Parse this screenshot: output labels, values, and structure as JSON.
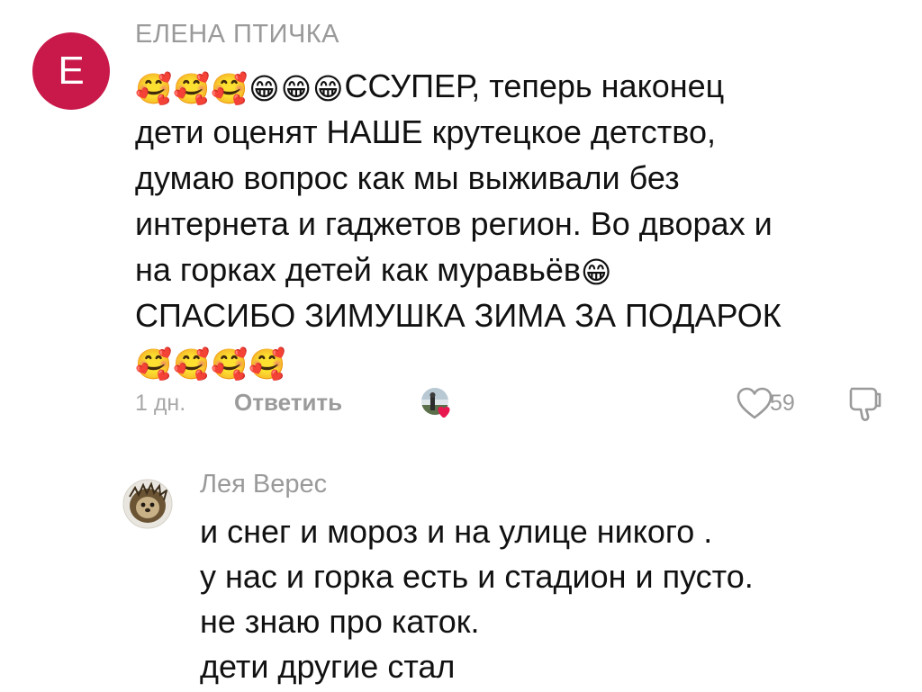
{
  "comment": {
    "avatar_letter": "E",
    "author": "ЕЛЕНА ПТИЧКА",
    "lines": [
      {
        "emojis": [
          "🥰",
          "🥰",
          "🥰",
          "😁",
          "😁",
          "😁"
        ],
        "text": "ССУПЕР, теперь наконец"
      },
      {
        "emojis": [],
        "text": "дети оценят НАШЕ крутецкое детство,"
      },
      {
        "emojis": [],
        "text": "думаю вопрос как мы выживали без"
      },
      {
        "emojis": [],
        "text": "интернета и гаджетов регион. Во дворах и"
      },
      {
        "emojis": [],
        "text": "на горках детей как муравьёв",
        "trailing_emoji": "😁"
      },
      {
        "emojis": [],
        "text": "СПАСИБО ЗИМУШКА ЗИМА ЗА ПОДАРОК"
      },
      {
        "emojis": [
          "🥰",
          "🥰",
          "🥰",
          "🥰"
        ],
        "text": ""
      }
    ],
    "time": "1 дн.",
    "reply_label": "Ответить",
    "like_count": "59",
    "colors": {
      "avatar_bg": "#c8194a",
      "like_heart_badge": "#e8174e",
      "meta_text": "#9a9a9a"
    },
    "icons": {
      "like": "heart-outline-icon",
      "dislike": "thumbs-down-outline-icon",
      "creator_liked_avatar": "creator-liked-avatar"
    }
  },
  "reply": {
    "author": "Лея Верес",
    "lines": [
      "и снег и мороз и на улице никого .",
      "у нас и горка есть и стадион и пусто.",
      "не знаю про каток.",
      "дети другие стал"
    ],
    "avatar_icon": "hedgehog-avatar"
  }
}
